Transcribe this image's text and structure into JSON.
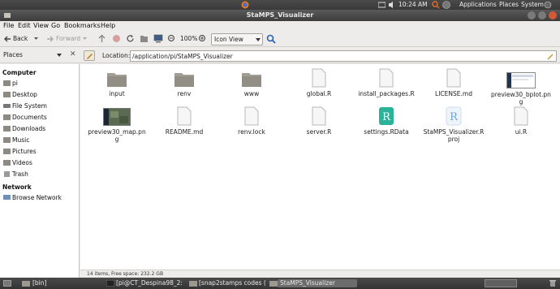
{
  "top_panel": {
    "time": "10:24 AM",
    "applications": "Applications",
    "places": "Places",
    "system": "System"
  },
  "window": {
    "title": "StaMPS_Visualizer"
  },
  "menubar": [
    "File",
    "Edit",
    "View",
    "Go",
    "Bookmarks",
    "Help"
  ],
  "toolbar": {
    "back": "Back",
    "forward": "Forward",
    "zoom": "100%",
    "view_mode": "Icon View"
  },
  "location": {
    "places_label": "Places",
    "label": "Location:",
    "path": "/application/pi/StaMPS_Visualizer"
  },
  "sidebar": {
    "computer_header": "Computer",
    "computer_items": [
      "pi",
      "Desktop",
      "File System",
      "Documents",
      "Downloads",
      "Music",
      "Pictures",
      "Videos",
      "Trash"
    ],
    "network_header": "Network",
    "network_items": [
      "Browse Network"
    ]
  },
  "files": [
    {
      "name": "input",
      "type": "folder"
    },
    {
      "name": "renv",
      "type": "folder"
    },
    {
      "name": "www",
      "type": "folder"
    },
    {
      "name": "global.R",
      "type": "doc"
    },
    {
      "name": "install_packages.R",
      "type": "doc"
    },
    {
      "name": "LICENSE.md",
      "type": "doc"
    },
    {
      "name": "preview30_bplot.png",
      "type": "image"
    },
    {
      "name": "preview30_map.png",
      "type": "image-map"
    },
    {
      "name": "README.md",
      "type": "doc"
    },
    {
      "name": "renv.lock",
      "type": "doc"
    },
    {
      "name": "server.R",
      "type": "doc"
    },
    {
      "name": "settings.RData",
      "type": "rdata"
    },
    {
      "name": "StaMPS_Visualizer.Rproj",
      "type": "rproj"
    },
    {
      "name": "ui.R",
      "type": "doc"
    }
  ],
  "status": "14 items, Free space: 232.2 GB",
  "taskbar": [
    "[bin]",
    "[pi@CT_Despina98_2: ...",
    "[snap2stamps codes (...",
    "StaMPS_Visualizer"
  ],
  "colors": {
    "panel": "#3c3c3c",
    "folder": "#9a948c",
    "rdata_green": "#2bb39a",
    "rproj_blue": "#6da4d8"
  }
}
